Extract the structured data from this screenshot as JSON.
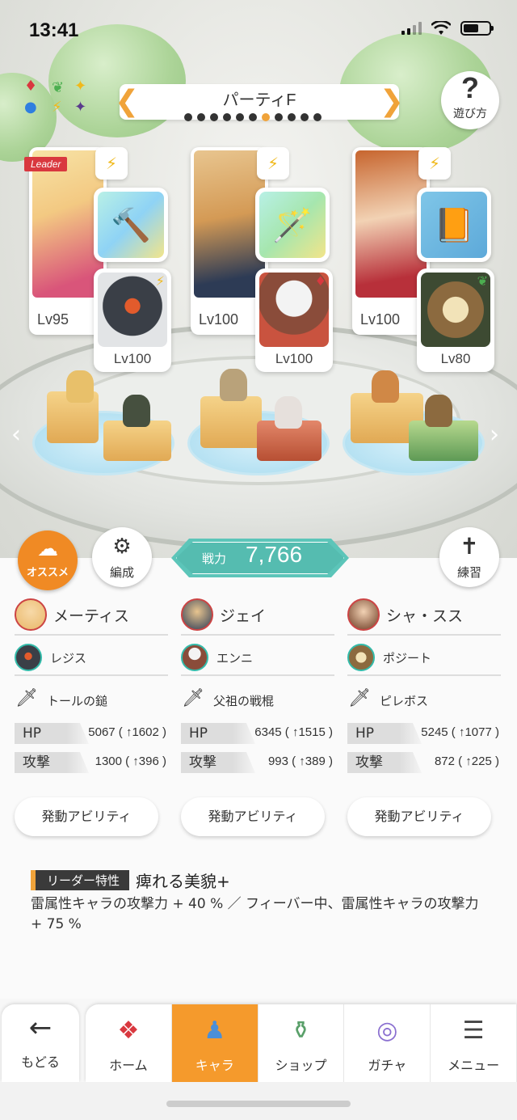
{
  "status_bar": {
    "time": "13:41"
  },
  "party": {
    "title": "パーティF",
    "dots": [
      0,
      0,
      0,
      0,
      0,
      0,
      1,
      0,
      0,
      0,
      0
    ],
    "help_label": "遊び方"
  },
  "characters": [
    {
      "leader_label": "Leader",
      "level": "Lv95",
      "sub_level": "Lv100",
      "sub_element": "⚡",
      "weapon_icon": "hammer-icon",
      "sub_element_color": "#f0b91b"
    },
    {
      "leader_label": "",
      "level": "Lv100",
      "sub_level": "Lv100",
      "sub_element": "♦",
      "weapon_icon": "staff-icon",
      "sub_element_color": "#d9383f"
    },
    {
      "leader_label": "",
      "level": "Lv100",
      "sub_level": "Lv80",
      "sub_element": "❦",
      "weapon_icon": "book-icon",
      "sub_element_color": "#4caf50"
    }
  ],
  "controls": {
    "recommend_label": "オススメ",
    "formation_label": "編成",
    "power_label": "戦力",
    "power_value": "7,766",
    "training_label": "練習"
  },
  "columns": [
    {
      "main_name": "メーティス",
      "sub_name": "レジス",
      "weapon": "トールの鎚",
      "hp_label": "HP",
      "hp_value": "5067 ( ↑1602 )",
      "atk_label": "攻撃",
      "atk_value": "1300 ( ↑396 )",
      "ability_label": "発動アビリティ"
    },
    {
      "main_name": "ジェイ",
      "sub_name": "エンニ",
      "weapon": "父祖の戦棍",
      "hp_label": "HP",
      "hp_value": "6345 ( ↑1515 )",
      "atk_label": "攻撃",
      "atk_value": "993 ( ↑389 )",
      "ability_label": "発動アビリティ"
    },
    {
      "main_name": "シャ・スス",
      "sub_name": "ポジート",
      "weapon": "ピレボス",
      "hp_label": "HP",
      "hp_value": "5245 ( ↑1077 )",
      "atk_label": "攻撃",
      "atk_value": "872 ( ↑225 )",
      "ability_label": "発動アビリティ"
    }
  ],
  "leader_trait": {
    "tag": "リーダー特性",
    "name": "痺れる美貌+",
    "description": "雷属性キャラの攻撃力 + 40 % ／ フィーバー中、雷属性キャラの攻撃力 + 75 %"
  },
  "nav": {
    "back_label": "もどる",
    "tabs": [
      {
        "label": "ホーム",
        "icon": "home-icon",
        "active": false
      },
      {
        "label": "キャラ",
        "icon": "character-icon",
        "active": true
      },
      {
        "label": "ショップ",
        "icon": "shop-icon",
        "active": false
      },
      {
        "label": "ガチャ",
        "icon": "gacha-icon",
        "active": false
      },
      {
        "label": "メニュー",
        "icon": "menu-icon",
        "active": false
      }
    ]
  },
  "colors": {
    "accent": "#f59a2c",
    "power_plate": "#5cc5b9",
    "leader_tag": "#d9383f",
    "lightning": "#f0b91b"
  }
}
